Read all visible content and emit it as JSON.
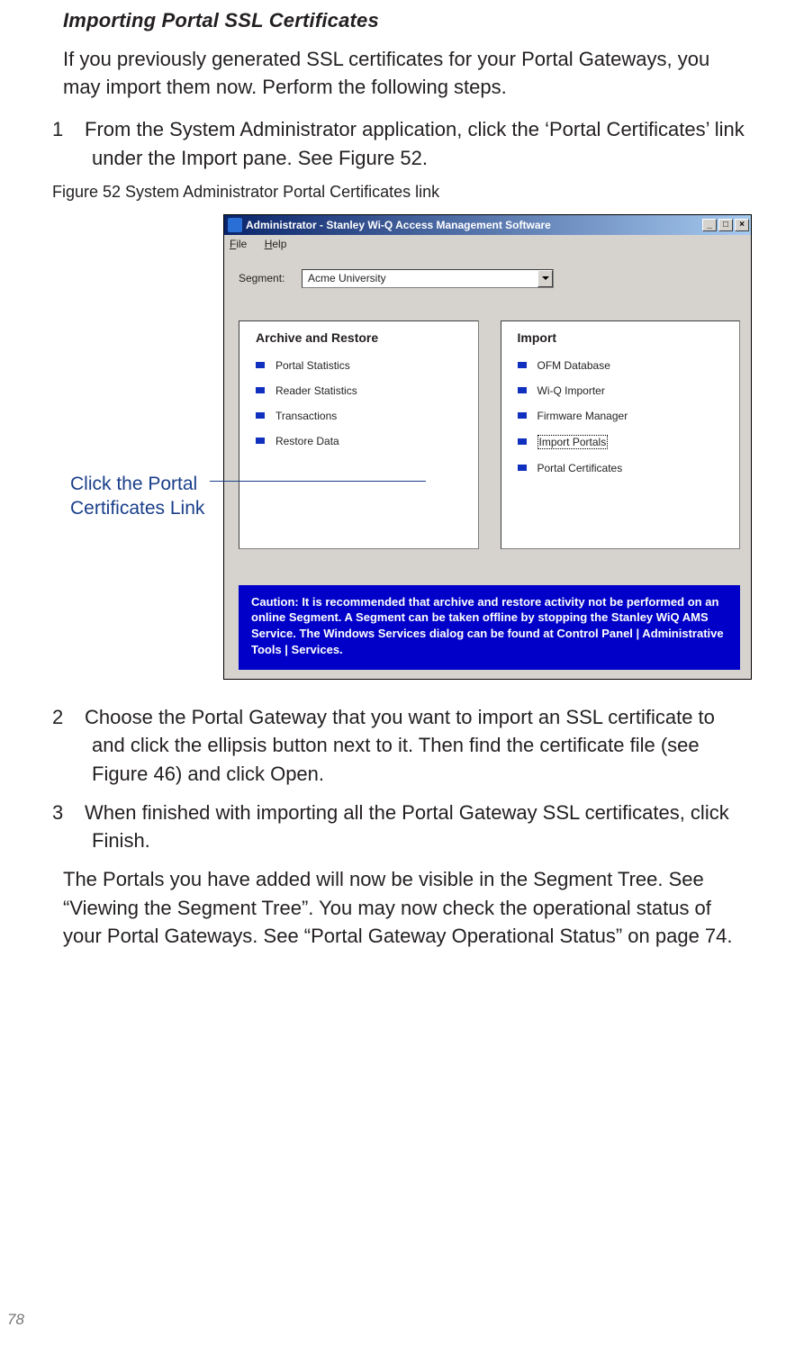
{
  "heading": "Importing Portal SSL Certificates",
  "intro": "If you previously generated SSL certificates for your Portal Gateways, you may import them now. Perform the following steps.",
  "steps_a": {
    "n1": "1",
    "t1": "From the System Administrator application, click the ‘Portal Certificates’ link under the Import pane. See Figure 52."
  },
  "figcaption": "Figure 52    System Administrator Portal Certificates link",
  "callout": "Click the Portal Certificates Link",
  "window": {
    "title": "Administrator - Stanley Wi-Q Access Management Software",
    "menu_file": "File",
    "menu_help": "Help",
    "segment_label": "Segment:",
    "segment_value": "Acme University",
    "pane_archive_title": "Archive and Restore",
    "archive_items": [
      "Portal Statistics",
      "Reader Statistics",
      "Transactions",
      "Restore Data"
    ],
    "pane_import_title": "Import",
    "import_items": [
      "OFM Database",
      "Wi-Q Importer",
      "Firmware Manager",
      "Import Portals",
      "Portal Certificates"
    ],
    "caution": "Caution: It is recommended that archive and restore activity not be performed on an online Segment.  A Segment can be taken offline by stopping the Stanley WiQ AMS Service.  The Windows Services dialog can be found at Control Panel | Administrative Tools | Services."
  },
  "steps_b": {
    "n2": "2",
    "t2": "Choose the Portal Gateway that you want to import an SSL certificate to and click the ellipsis button next to it. Then find the certificate file (see Figure 46) and click Open.",
    "n3": "3",
    "t3": "When finished with importing all the Portal Gateway SSL certificates, click Finish."
  },
  "closing": "The Portals you have added will now be visible in the Segment Tree. See “Viewing the Segment Tree”. You may now check the operational status of your Portal Gateways. See “Portal Gateway Operational Status” on page 74.",
  "page_number": "78"
}
